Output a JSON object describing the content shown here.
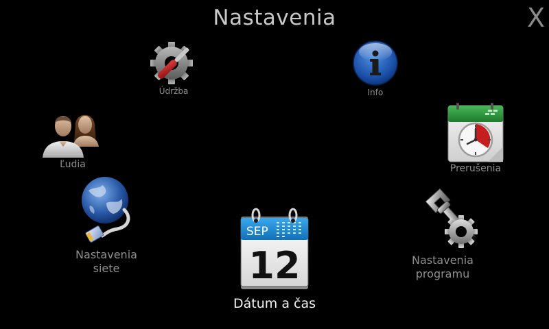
{
  "header": {
    "title": "Nastavenia",
    "close_label": "X"
  },
  "items": {
    "udrzba": {
      "label": "Údržba",
      "icon": "gear-wrench-icon"
    },
    "info": {
      "label": "Info",
      "icon": "info-icon"
    },
    "ludia": {
      "label": "Ľudia",
      "icon": "people-icon"
    },
    "prerusenia": {
      "label": "Prerušenia",
      "icon": "calendar-clock-icon"
    },
    "siete": {
      "label": "Nastavenia\nsiete",
      "icon": "network-globe-icon"
    },
    "program": {
      "label": "Nastavenia\nprogramu",
      "icon": "wrench-gear-icon"
    },
    "datum": {
      "label": "Dátum a čas",
      "icon": "calendar-icon",
      "month": "SEP",
      "day": "12"
    }
  },
  "colors": {
    "background": "#000000",
    "label": "#8f8f8f",
    "selected_label": "#f2f2f2",
    "calendar_header": "#1c8fd6",
    "break_header": "#2e9a3e"
  }
}
